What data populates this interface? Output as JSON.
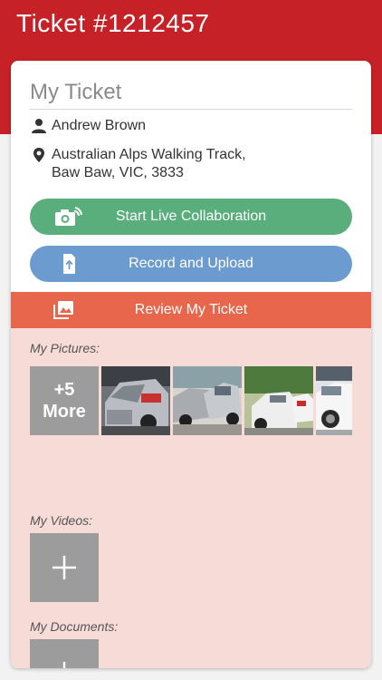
{
  "header": {
    "title": "Ticket #1212457",
    "background": "#c62127"
  },
  "card": {
    "title": "My Ticket",
    "user_name": "Andrew Brown",
    "address_line1": "Australian Alps Walking Track,",
    "address_line2": "Baw Baw, VIC, 3833",
    "person_icon": "person-icon",
    "location_icon": "location-pin-icon"
  },
  "actions": {
    "collab_label": "Start Live Collaboration",
    "collab_icon": "camera-live-icon",
    "collab_color": "#5aae7c",
    "upload_label": "Record and Upload",
    "upload_icon": "upload-file-icon",
    "upload_color": "#6b9bcf",
    "review_label": "Review My Ticket",
    "review_icon": "image-gallery-icon",
    "review_color": "#e8664b"
  },
  "media": {
    "background": "#f6dbd6",
    "pictures_label": "My Pictures:",
    "more_count": "+5",
    "more_label": "More",
    "pictures": [
      {
        "name": "damaged-car-photo-1"
      },
      {
        "name": "damaged-car-photo-2"
      },
      {
        "name": "damaged-car-photo-3"
      },
      {
        "name": "damaged-car-photo-4"
      }
    ],
    "videos_label": "My Videos:",
    "documents_label": "My Documents:",
    "add_icon": "plus-icon"
  }
}
